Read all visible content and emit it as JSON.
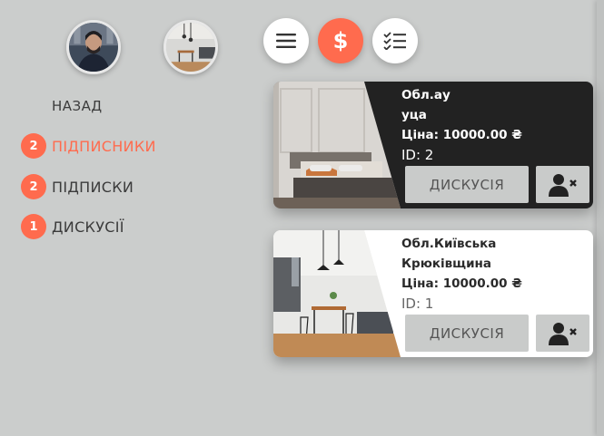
{
  "colors": {
    "accent": "#ff6b4e",
    "background": "#cbcdcc",
    "card_dark": "#222222",
    "card_light": "#ffffff"
  },
  "header": {
    "avatars": [
      {
        "name": "user-avatar"
      },
      {
        "name": "room-avatar"
      }
    ],
    "buttons": [
      {
        "icon": "hamburger-menu-icon"
      },
      {
        "icon": "dollar-icon",
        "label": "$",
        "active": true
      },
      {
        "icon": "checklist-icon"
      }
    ]
  },
  "sidebar": {
    "back_label": "НАЗАД",
    "items": [
      {
        "badge": "2",
        "label": "ПІДПИСНИКИ",
        "active": true
      },
      {
        "badge": "2",
        "label": "ПІДПИСКИ",
        "active": false
      },
      {
        "badge": "1",
        "label": "ДИСКУСІЇ",
        "active": false
      }
    ]
  },
  "listings": [
    {
      "region_line1": "Обл.ау",
      "region_line2": "уца",
      "price": "Ціна: 10000.00 ₴",
      "id": "ID: 2",
      "discuss_label": "ДИСКУСІЯ",
      "unfollow_icon": "user-remove-icon"
    },
    {
      "region_line1": "Обл.Київська",
      "region_line2": "Крюківщина",
      "price": "Ціна: 10000.00 ₴",
      "id": "ID: 1",
      "discuss_label": "ДИСКУСІЯ",
      "unfollow_icon": "user-remove-icon"
    }
  ]
}
